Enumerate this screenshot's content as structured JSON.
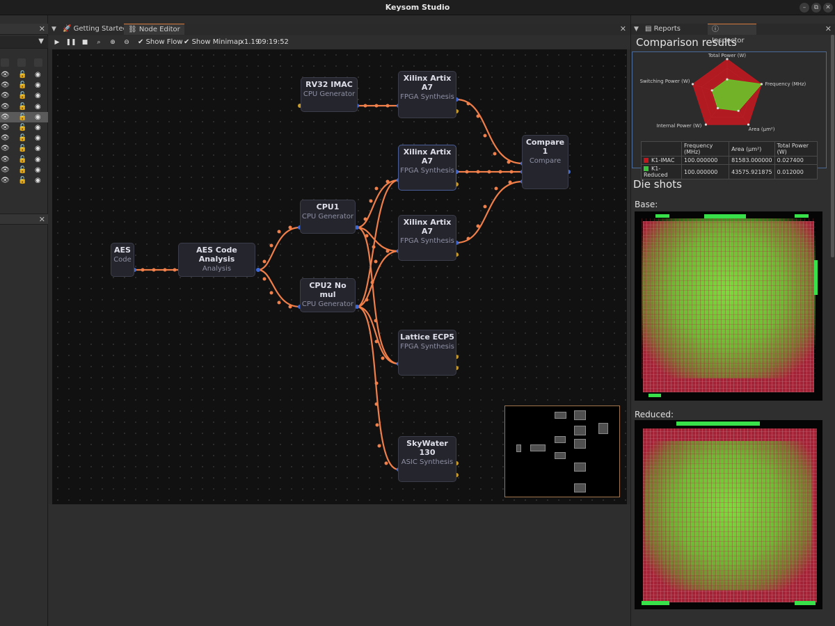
{
  "window": {
    "title": "Keysom Studio",
    "minimize_icon": "–",
    "restore_icon": "⧉",
    "close_icon": "✕"
  },
  "center": {
    "tabs": [
      {
        "label": "Getting Started",
        "icon": "rocket-icon"
      },
      {
        "label": "Node Editor",
        "icon": "node-graph-icon"
      }
    ]
  },
  "toolbar": {
    "show_flow": "Show Flow",
    "show_minimap": "Show Minimap",
    "zoom": "x1.19",
    "time": "09:19:52"
  },
  "nodes": [
    {
      "id": "aes",
      "title": "AES",
      "subtitle": "Code"
    },
    {
      "id": "aes_analysis",
      "title": "AES Code Analysis",
      "subtitle": "Analysis"
    },
    {
      "id": "rv32",
      "title": "RV32 IMAC",
      "subtitle": "CPU Generator"
    },
    {
      "id": "cpu1",
      "title": "CPU1",
      "subtitle": "CPU Generator"
    },
    {
      "id": "cpu2",
      "title": "CPU2 No mul",
      "subtitle": "CPU Generator"
    },
    {
      "id": "artix1",
      "title": "Xilinx Artix A7",
      "subtitle": "FPGA Synthesis"
    },
    {
      "id": "artix2",
      "title": "Xilinx Artix A7",
      "subtitle": "FPGA Synthesis"
    },
    {
      "id": "artix3",
      "title": "Xilinx Artix A7",
      "subtitle": "FPGA Synthesis"
    },
    {
      "id": "ecp5",
      "title": "Lattice ECP5",
      "subtitle": "FPGA Synthesis"
    },
    {
      "id": "sky130",
      "title": "SkyWater 130",
      "subtitle": "ASIC Synthesis"
    },
    {
      "id": "compare",
      "title": "Compare 1",
      "subtitle": "Compare"
    }
  ],
  "right": {
    "tabs": [
      {
        "label": "Reports",
        "icon": "report-icon"
      },
      {
        "label": "Inspector",
        "icon": "info-icon"
      }
    ],
    "comparison_title": "Comparison results",
    "radar": {
      "axes": [
        "Total Power (W)",
        "Frequency (MHz)",
        "Area (µm²)",
        "Internal Power (W)",
        "Switching Power (W)"
      ],
      "series": [
        {
          "name": "K1-IMAC",
          "color": "#c0181f",
          "values": [
            1.0,
            1.0,
            1.0,
            1.0,
            1.0
          ]
        },
        {
          "name": "K1-Reduced",
          "color": "#6ac32a",
          "values": [
            0.44,
            1.0,
            0.53,
            0.44,
            0.44
          ]
        }
      ]
    },
    "table": {
      "headers": [
        "",
        "Frequency (MHz)",
        "Area (µm²)",
        "Total Power (W)"
      ],
      "rows": [
        {
          "name": "K1-IMAC",
          "color": "#c0181f",
          "freq": "100.000000",
          "area": "81583.000000",
          "power": "0.027400"
        },
        {
          "name": "K1-Reduced",
          "color": "#3cc23c",
          "freq": "100.000000",
          "area": "43575.921875",
          "power": "0.012000"
        }
      ]
    },
    "die_title": "Die shots",
    "base_label": "Base:",
    "reduced_label": "Reduced:"
  }
}
